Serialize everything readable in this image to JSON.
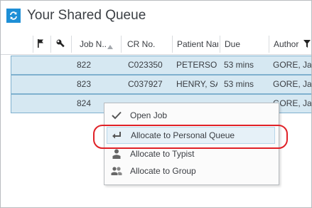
{
  "window": {
    "title": "Your Shared Queue",
    "icon": "refresh-icon"
  },
  "header": {
    "icons": [
      "flag-icon",
      "wrench-icon"
    ],
    "columns": {
      "job": "Job N..",
      "cr": "CR No.",
      "patient": "Patient Nar",
      "due": "Due",
      "author": "Author"
    },
    "sort_icon": "sort-ascending-icon",
    "filter_icon": "filter-icon"
  },
  "rows": [
    {
      "job": "822",
      "cr": "C023350",
      "patient": "PETERSON",
      "due": "53 mins",
      "author": "GORE, Jam"
    },
    {
      "job": "823",
      "cr": "C037927",
      "patient": "HENRY, SA",
      "due": "53 mins",
      "author": "GORE, Jam"
    },
    {
      "job": "824",
      "cr": "",
      "patient": "",
      "due": "",
      "author": "GORE, Jam"
    }
  ],
  "context_menu": {
    "items": [
      {
        "label": "Open Job",
        "icon": "check-icon"
      },
      {
        "label": "Allocate to Personal Queue",
        "icon": "return-arrow-icon"
      },
      {
        "label": "Allocate to Typist",
        "icon": "person-icon"
      },
      {
        "label": "Allocate to Group",
        "icon": "people-group-icon"
      }
    ],
    "highlighted_item": "Allocate to Personal Queue"
  },
  "colors": {
    "accent": "#1e8fd6",
    "row_selected": "#d6e8f2",
    "row_border": "#7fb1cf",
    "callout": "#e02127"
  }
}
